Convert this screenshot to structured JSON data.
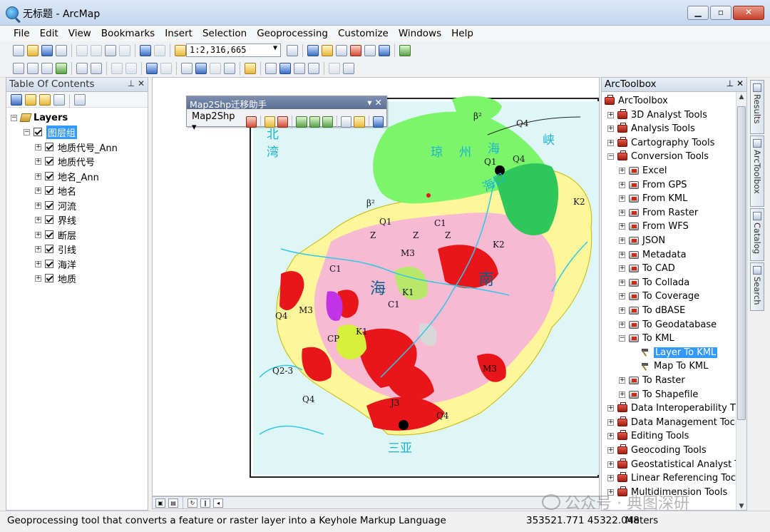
{
  "window": {
    "title": "无标题 - ArcMap"
  },
  "menu": [
    "File",
    "Edit",
    "View",
    "Bookmarks",
    "Insert",
    "Selection",
    "Geoprocessing",
    "Customize",
    "Windows",
    "Help"
  ],
  "toolbar": {
    "scale": "1:2,316,665"
  },
  "toc": {
    "title": "Table Of Contents",
    "root": "Layers",
    "group": "图层组",
    "layers": [
      "地质代号_Ann",
      "地质代号",
      "地名_Ann",
      "地名",
      "河流",
      "界线",
      "断层",
      "引线",
      "海洋",
      "地质"
    ]
  },
  "float_toolbar": {
    "title": "Map2Shp迁移助手",
    "dropdown": "Map2Shp"
  },
  "map_labels": {
    "hai": "海",
    "nan": "南",
    "qiongzhou": "琼",
    "zhou": "州",
    "haixia": "海",
    "xia": "峡",
    "beibu": "北",
    "bay": "湾",
    "haikou": "海口",
    "sanya": "三亚",
    "codes": [
      "β²",
      "β²",
      "Q4",
      "Q4",
      "Q1",
      "Q1",
      "K2",
      "K2",
      "K1",
      "K1",
      "M3",
      "M3",
      "M3",
      "C1",
      "C1",
      "C1",
      "J3",
      "Z",
      "Z",
      "Z",
      "Q2-3",
      "CP",
      "Q4",
      "Q4",
      "Q4"
    ]
  },
  "arctoolbox": {
    "title": "ArcToolbox",
    "root": "ArcToolbox",
    "items": [
      {
        "label": "3D Analyst Tools",
        "type": "toolbox",
        "level": 1,
        "exp": "+"
      },
      {
        "label": "Analysis Tools",
        "type": "toolbox",
        "level": 1,
        "exp": "+"
      },
      {
        "label": "Cartography Tools",
        "type": "toolbox",
        "level": 1,
        "exp": "+"
      },
      {
        "label": "Conversion Tools",
        "type": "toolbox",
        "level": 1,
        "exp": "−"
      },
      {
        "label": "Excel",
        "type": "toolset",
        "level": 2,
        "exp": "+"
      },
      {
        "label": "From GPS",
        "type": "toolset",
        "level": 2,
        "exp": "+"
      },
      {
        "label": "From KML",
        "type": "toolset",
        "level": 2,
        "exp": "+"
      },
      {
        "label": "From Raster",
        "type": "toolset",
        "level": 2,
        "exp": "+"
      },
      {
        "label": "From WFS",
        "type": "toolset",
        "level": 2,
        "exp": "+"
      },
      {
        "label": "JSON",
        "type": "toolset",
        "level": 2,
        "exp": "+"
      },
      {
        "label": "Metadata",
        "type": "toolset",
        "level": 2,
        "exp": "+"
      },
      {
        "label": "To CAD",
        "type": "toolset",
        "level": 2,
        "exp": "+"
      },
      {
        "label": "To Collada",
        "type": "toolset",
        "level": 2,
        "exp": "+"
      },
      {
        "label": "To Coverage",
        "type": "toolset",
        "level": 2,
        "exp": "+"
      },
      {
        "label": "To dBASE",
        "type": "toolset",
        "level": 2,
        "exp": "+"
      },
      {
        "label": "To Geodatabase",
        "type": "toolset",
        "level": 2,
        "exp": "+"
      },
      {
        "label": "To KML",
        "type": "toolset",
        "level": 2,
        "exp": "−"
      },
      {
        "label": "Layer To KML",
        "type": "tool",
        "level": 3,
        "selected": true
      },
      {
        "label": "Map To KML",
        "type": "tool",
        "level": 3
      },
      {
        "label": "To Raster",
        "type": "toolset",
        "level": 2,
        "exp": "+"
      },
      {
        "label": "To Shapefile",
        "type": "toolset",
        "level": 2,
        "exp": "+"
      },
      {
        "label": "Data Interoperability T",
        "type": "toolbox",
        "level": 1,
        "exp": "+"
      },
      {
        "label": "Data Management Toc",
        "type": "toolbox",
        "level": 1,
        "exp": "+"
      },
      {
        "label": "Editing Tools",
        "type": "toolbox",
        "level": 1,
        "exp": "+"
      },
      {
        "label": "Geocoding Tools",
        "type": "toolbox",
        "level": 1,
        "exp": "+"
      },
      {
        "label": "Geostatistical Analyst T",
        "type": "toolbox",
        "level": 1,
        "exp": "+"
      },
      {
        "label": "Linear Referencing Toc",
        "type": "toolbox",
        "level": 1,
        "exp": "+"
      },
      {
        "label": "Multidimension Tools",
        "type": "toolbox",
        "level": 1,
        "exp": "+"
      }
    ]
  },
  "side_tabs": [
    "Results",
    "ArcToolbox",
    "Catalog",
    "Search"
  ],
  "status": {
    "message": "Geoprocessing tool that converts a feature or raster layer into a Keyhole Markup Language",
    "coords": "353521.771  45322.048",
    "units": "Meters"
  },
  "watermark": "公众号 · 典图深研"
}
